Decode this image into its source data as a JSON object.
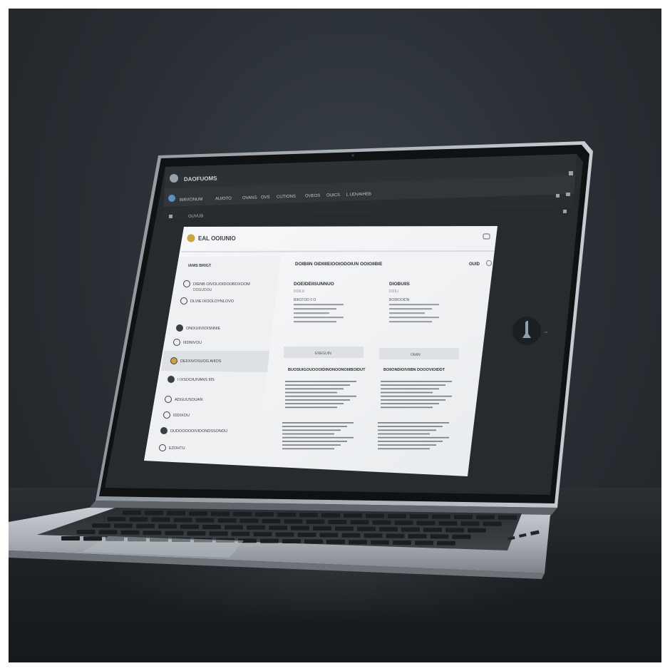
{
  "scene": "laptop on a dark desk displaying a web application",
  "colors": {
    "background": "#2a3035",
    "laptop_body": "#b9bec3",
    "bezel": "#111315",
    "app_chrome": "#2e3337",
    "app_card": "#f4f5f6",
    "sidebar_highlight": "#e3e6e9",
    "gold_icon": "#c9a640"
  },
  "app": {
    "title": "DAOFUOMS",
    "nav_items": [
      "BIRXONUM",
      "AUIOTO",
      "OVANS",
      "OVS",
      "CUTIONS",
      "OVEOS",
      "OUICS",
      "L UDVAIHEB"
    ],
    "breadcrumb": "OUVUB",
    "card_title": "EAL OOIUNIO",
    "sidebar": [
      {
        "label": "IAMS BRIGT",
        "icon": "none"
      },
      {
        "label": "DIENB OIVOLIOIDOOBOXOOM",
        "sub": "DOGUDOU",
        "icon": "refresh-icon"
      },
      {
        "label": "DLVIE IXOOLOYNLOVO",
        "icon": "clip-icon"
      },
      {
        "label": "ONIXUIIVIOISNNIE",
        "icon": "folder-icon"
      },
      {
        "label": "IIIDNIVOU",
        "icon": "gear-icon"
      },
      {
        "label": "DEIIXIVOSUOG AIIIOS",
        "icon": "coin-icon"
      },
      {
        "label": "I IXSOOIUIVANS IIIS",
        "icon": "user-icon"
      },
      {
        "label": "ADGUUSOUAN",
        "icon": "book-icon"
      },
      {
        "label": "IDDIXOU",
        "icon": "doc-icon"
      },
      {
        "label": "DUDOOOOOIVIDONDSSONOU",
        "icon": "cloud-icon"
      },
      {
        "label": "EZOHTU",
        "icon": "grid-icon"
      }
    ],
    "content_header": "DOIBIIN OIDIIIIEIOOIODOIUN OOIOIIBIE",
    "content_header_right": "OUID",
    "columns": [
      {
        "heading": "DOEIDEIISUNNUO",
        "subheading": "DOILU",
        "value_label": "BIIIOTOD I! O",
        "button": "ENEGUIN",
        "section_title": "BUOSUIGOUOOOIDINONOONOIIIBOIDUT"
      },
      {
        "heading": "DIOBUIIS",
        "subheading": "DOILI",
        "value_label": "BOIBOOIDN",
        "button": "OIIAN",
        "section_title": "BOIIONDIOIVIIBN DOOOVIOIDDT"
      }
    ]
  }
}
